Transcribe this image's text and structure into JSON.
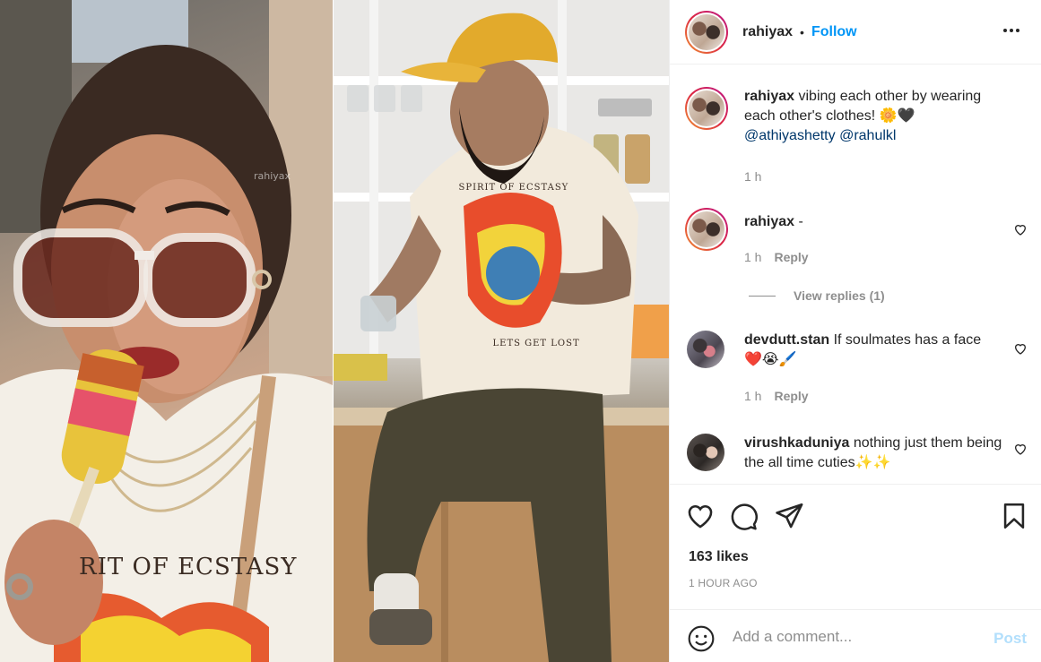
{
  "post": {
    "watermark": "rahiyax",
    "left_shirt_text": "RIT OF ECSTASY",
    "right_shirt_text": "SPIRIT OF ECSTASY",
    "right_shirt_text2": "LETS GET LOST"
  },
  "header": {
    "username": "rahiyax",
    "separator": "•",
    "follow_label": "Follow",
    "more_icon": "more-horizontal-icon"
  },
  "caption": {
    "username": "rahiyax",
    "text": "vibing each other by wearing each other's clothes! 🌼🖤",
    "mention1": "@athiyashetty",
    "mention2": "@rahulkl",
    "time": "1 h"
  },
  "comments": [
    {
      "username": "rahiyax",
      "text": "-",
      "time": "1 h",
      "reply_label": "Reply",
      "view_replies": "View replies (1)"
    },
    {
      "username": "devdutt.stan",
      "text": "If soulmates has a face",
      "emoji": "❤️😭🖌️",
      "time": "1 h",
      "reply_label": "Reply"
    },
    {
      "username": "virushkaduniya",
      "text": "nothing just them being the all time cuties✨✨"
    }
  ],
  "actions": {
    "like_icon": "heart-icon",
    "comment_icon": "comment-icon",
    "share_icon": "send-icon",
    "save_icon": "bookmark-icon",
    "likes": "163 likes",
    "time_ago": "1 HOUR AGO"
  },
  "comment_box": {
    "emoji_icon": "smiley-icon",
    "placeholder": "Add a comment...",
    "post_label": "Post"
  },
  "colors": {
    "link_blue": "#0095f6",
    "mention": "#00376b",
    "muted": "#8e8e8e",
    "post_disabled": "#b2dffc"
  }
}
